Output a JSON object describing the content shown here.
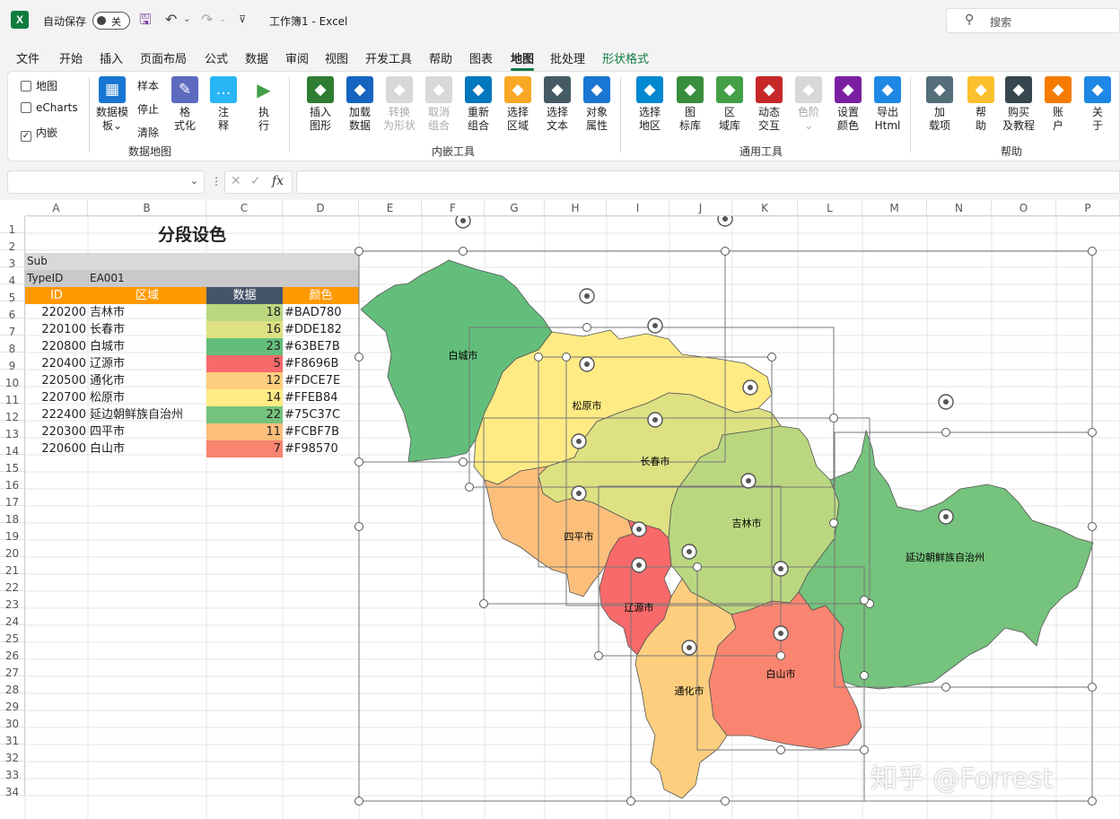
{
  "titlebar": {
    "app_icon": "excel-logo",
    "autosave_label": "自动保存",
    "autosave_state": "关",
    "doc_title": "工作簿1  -  Excel",
    "search_placeholder": "搜索"
  },
  "menu": {
    "tabs": [
      "文件",
      "开始",
      "插入",
      "页面布局",
      "公式",
      "数据",
      "审阅",
      "视图",
      "开发工具",
      "帮助",
      "图表",
      "地图",
      "批处理",
      "形状格式"
    ],
    "active": "地图"
  },
  "ribbon": {
    "checks": [
      {
        "label": "地图",
        "checked": false
      },
      {
        "label": "eCharts",
        "checked": false
      },
      {
        "label": "内嵌",
        "checked": true
      }
    ],
    "template_btn": "数据模\n板⌄",
    "sample": "样本",
    "stop": "停止",
    "clear": "清除",
    "format_btn": "格\n式化",
    "note_btn": "注\n释",
    "run_btn": "执\n行",
    "group1": "数据地图",
    "embed_buttons": [
      {
        "label": "插入\n图形",
        "icon": "insert-shape-icon",
        "color": "#2e7d32"
      },
      {
        "label": "加载\n数据",
        "icon": "load-data-icon",
        "color": "#1565c0"
      },
      {
        "label": "转换\n为形状",
        "icon": "convert-shape-icon",
        "color": "#999",
        "disabled": true
      },
      {
        "label": "取消\n组合",
        "icon": "ungroup-icon",
        "color": "#999",
        "disabled": true
      },
      {
        "label": "重新\n组合",
        "icon": "regroup-icon",
        "color": "#0277bd"
      },
      {
        "label": "选择\n区域",
        "icon": "select-region-icon",
        "color": "#f9a825"
      },
      {
        "label": "选择\n文本",
        "icon": "select-text-icon",
        "color": "#455a64"
      },
      {
        "label": "对象\n属性",
        "icon": "object-props-icon",
        "color": "#1976d2"
      }
    ],
    "group2": "内嵌工具",
    "general_buttons": [
      {
        "label": "选择\n地区",
        "icon": "select-area-icon",
        "color": "#0288d1"
      },
      {
        "label": "图\n标库",
        "icon": "flag-icon",
        "color": "#388e3c"
      },
      {
        "label": "区\n域库",
        "icon": "africa-map-icon",
        "color": "#43a047"
      },
      {
        "label": "动态\n交互",
        "icon": "pen-icon",
        "color": "#c62828"
      },
      {
        "label": "色阶\n⌄",
        "icon": "color-scale-icon",
        "color": "#999",
        "disabled": true
      },
      {
        "label": "设置\n颜色",
        "icon": "palette-icon",
        "color": "#7b1fa2"
      },
      {
        "label": "导出\nHtml",
        "icon": "export-html-icon",
        "color": "#1e88e5"
      }
    ],
    "group3": "通用工具",
    "help_buttons": [
      {
        "label": "加\n载项",
        "icon": "addin-icon",
        "color": "#546e7a"
      },
      {
        "label": "帮\n助",
        "icon": "bulb-icon",
        "color": "#fbc02d"
      },
      {
        "label": "购买\n及教程",
        "icon": "binoculars-icon",
        "color": "#37474f"
      },
      {
        "label": "账\n户",
        "icon": "account-icon",
        "color": "#f57c00"
      },
      {
        "label": "关\n于",
        "icon": "question-icon",
        "color": "#1e88e5"
      }
    ],
    "group4": "帮助"
  },
  "formula_bar": {
    "name_box": "",
    "formula": "",
    "fx": "fx",
    "cancel": "✕",
    "enter": "✓"
  },
  "sheet": {
    "columns": [
      "A",
      "B",
      "C",
      "D",
      "E",
      "F",
      "G",
      "H",
      "I",
      "J",
      "K",
      "L",
      "M",
      "N",
      "O",
      "P"
    ],
    "rows": [
      "1",
      "2",
      "3",
      "4",
      "5",
      "6",
      "7",
      "8",
      "9",
      "10",
      "11",
      "12",
      "13",
      "14",
      "15",
      "16",
      "17",
      "18",
      "19",
      "20",
      "21",
      "22",
      "23",
      "24",
      "25",
      "26",
      "27",
      "28",
      "29",
      "30",
      "31",
      "32",
      "33",
      "34"
    ],
    "title": "分段设色",
    "sub_label": "Sub",
    "typeid_label": "TypeID",
    "typeid_value": "EA001",
    "headers": [
      "ID",
      "区域",
      "数据",
      "颜色"
    ],
    "table": [
      {
        "id": "220200",
        "name": "吉林市",
        "value": "18",
        "color": "#BAD780"
      },
      {
        "id": "220100",
        "name": "长春市",
        "value": "16",
        "color": "#DDE182"
      },
      {
        "id": "220800",
        "name": "白城市",
        "value": "23",
        "color": "#63BE7B"
      },
      {
        "id": "220400",
        "name": "辽源市",
        "value": "5",
        "color": "#F8696B"
      },
      {
        "id": "220500",
        "name": "通化市",
        "value": "12",
        "color": "#FDCE7E"
      },
      {
        "id": "220700",
        "name": "松原市",
        "value": "14",
        "color": "#FFEB84"
      },
      {
        "id": "222400",
        "name": "延边朝鲜族自治州",
        "value": "22",
        "color": "#75C37C"
      },
      {
        "id": "220300",
        "name": "四平市",
        "value": "11",
        "color": "#FCBF7B"
      },
      {
        "id": "220600",
        "name": "白山市",
        "value": "7",
        "color": "#F98570"
      }
    ]
  },
  "map_labels": {
    "baicheng": "白城市",
    "songyuan": "松原市",
    "changchun": "长春市",
    "jilin": "吉林市",
    "siping": "四平市",
    "liaoyuan": "辽源市",
    "yanbian": "延边朝鲜族自治州",
    "baishan": "白山市",
    "tonghua": "通化市"
  },
  "watermark": "知乎 @Forrest"
}
